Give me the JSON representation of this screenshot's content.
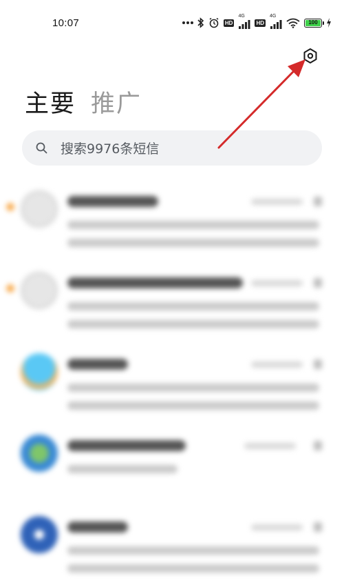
{
  "status_bar": {
    "time": "10:07",
    "battery": "100",
    "hd_badge": "HD",
    "network_label": "4G",
    "icons": [
      "more-dots-icon",
      "bluetooth-icon",
      "alarm-icon",
      "hd-icon",
      "signal-icon",
      "hd-icon",
      "signal-icon",
      "wifi-icon",
      "battery-icon",
      "charging-icon"
    ]
  },
  "header": {
    "settings_icon": "settings-hexagon-icon",
    "tabs": [
      {
        "label": "主要",
        "active": true
      },
      {
        "label": "推广",
        "active": false
      }
    ]
  },
  "search": {
    "icon": "search-icon",
    "placeholder": "搜索9976条短信"
  },
  "messages": [
    {
      "avatar": "default-contact-icon",
      "unread": true
    },
    {
      "avatar": "default-contact-icon",
      "unread": true
    },
    {
      "avatar": "weather-icon",
      "unread": false
    },
    {
      "avatar": "globe-icon",
      "unread": false
    },
    {
      "avatar": "bank-icon",
      "unread": false
    }
  ],
  "colors": {
    "accent_unread": "#f7a13b",
    "annotation_arrow": "#d42a2a",
    "battery_fill": "#3fd14a",
    "search_bg": "#f1f2f4",
    "tab_inactive": "#9a9a9a"
  }
}
